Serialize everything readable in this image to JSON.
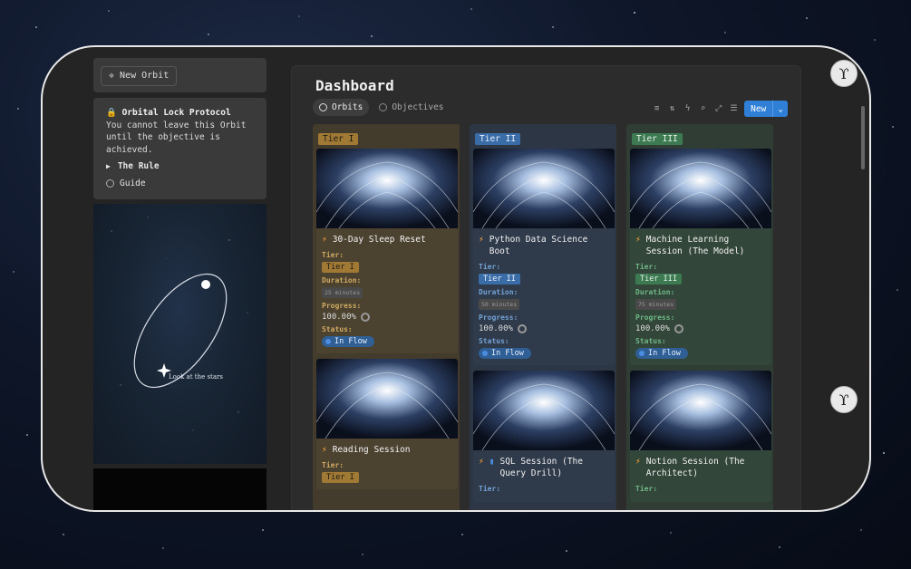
{
  "sidebar": {
    "new_orbit_label": "New Orbit",
    "lock_title": "Orbital Lock Protocol",
    "lock_text": "You cannot leave this Orbit until the objective is achieved.",
    "rule_label": "The Rule",
    "guide_label": "Guide",
    "art_caption": "Look at the stars"
  },
  "dashboard": {
    "title": "Dashboard",
    "tabs": [
      {
        "label": "Orbits",
        "active": true
      },
      {
        "label": "Objectives",
        "active": false
      }
    ],
    "toolbar_icons": [
      "filter-icon",
      "sort-icon",
      "bolt-icon",
      "search-icon",
      "expand-icon",
      "settings-icon"
    ],
    "new_button_label": "New"
  },
  "field_labels": {
    "tier": "Tier:",
    "duration": "Duration:",
    "progress": "Progress:",
    "status": "Status:"
  },
  "columns": [
    {
      "header": "Tier I",
      "color": "#a07a35",
      "cards": [
        {
          "title": "30-Day Sleep Reset",
          "tier": "Tier I",
          "duration": "25 minutes",
          "progress": "100.00%",
          "status": "In Flow"
        },
        {
          "title": "Reading Session",
          "tier": "Tier I"
        }
      ]
    },
    {
      "header": "Tier II",
      "color": "#3a6da8",
      "cards": [
        {
          "title": "Python Data Science Boot",
          "tier": "Tier II",
          "duration": "50 minutes",
          "progress": "100.00%",
          "status": "In Flow"
        },
        {
          "title": "SQL Session (The Query Drill)",
          "tier": ""
        }
      ]
    },
    {
      "header": "Tier III",
      "color": "#3d7a52",
      "cards": [
        {
          "title": "Machine Learning Session (The Model)",
          "tier": "Tier III",
          "duration": "75 minutes",
          "progress": "100.00%",
          "status": "In Flow"
        },
        {
          "title": "Notion Session (The Architect)",
          "tier": ""
        }
      ]
    }
  ]
}
